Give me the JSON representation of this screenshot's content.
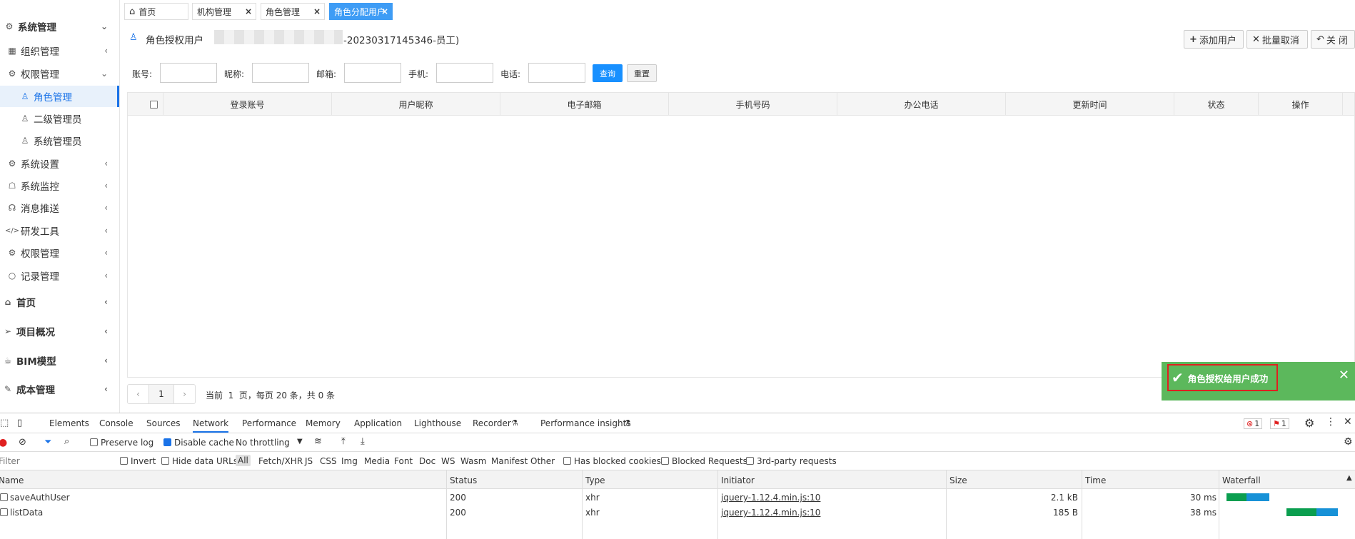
{
  "sidebar": {
    "items": [
      {
        "label": "系统管理",
        "icon": "gear-icon",
        "chev": "⌄"
      },
      {
        "label": "组织管理",
        "icon": "grid-icon",
        "chev": "‹"
      },
      {
        "label": "权限管理",
        "icon": "gear-icon",
        "chev": "⌄"
      },
      {
        "label": "角色管理",
        "icon": "user-icon"
      },
      {
        "label": "二级管理员",
        "icon": "user-icon"
      },
      {
        "label": "系统管理员",
        "icon": "users-icon"
      },
      {
        "label": "系统设置",
        "icon": "gear-icon",
        "chev": "‹"
      },
      {
        "label": "系统监控",
        "icon": "monitor-icon",
        "chev": "‹"
      },
      {
        "label": "消息推送",
        "icon": "headset-icon",
        "chev": "‹"
      },
      {
        "label": "研发工具",
        "icon": "code-icon",
        "chev": "‹"
      },
      {
        "label": "权限管理",
        "icon": "gear-icon",
        "chev": "‹"
      },
      {
        "label": "记录管理",
        "icon": "circle-icon",
        "chev": "‹"
      },
      {
        "label": "首页",
        "icon": "home-icon",
        "chev": "‹"
      },
      {
        "label": "项目概况",
        "icon": "send-icon",
        "chev": "‹"
      },
      {
        "label": "BIM模型",
        "icon": "cup-icon",
        "chev": "‹"
      },
      {
        "label": "成本管理",
        "icon": "pencil-icon",
        "chev": "‹"
      }
    ]
  },
  "tabs": [
    {
      "label": "首页",
      "icon": "home-icon"
    },
    {
      "label": "机构管理",
      "close": "×"
    },
    {
      "label": "角色管理",
      "close": "×"
    },
    {
      "label": "角色分配用户",
      "close": "×"
    }
  ],
  "header": {
    "title": "角色授权用户",
    "subtitle": "-20230317145346-员工)",
    "add_user": "添加用户",
    "batch_cancel": "批量取消",
    "close": "关 闭"
  },
  "search": {
    "account": "账号:",
    "nickname": "昵称:",
    "email": "邮箱:",
    "phone": "手机:",
    "tel": "电话:",
    "query": "查询",
    "reset": "重置"
  },
  "table": {
    "columns": [
      "登录账号",
      "用户昵称",
      "电子邮箱",
      "手机号码",
      "办公电话",
      "更新时间",
      "状态",
      "操作"
    ]
  },
  "pagination": {
    "prev": "‹",
    "page": "1",
    "next": "›",
    "info": "当前  1  页，每页 20 条，共 0 条"
  },
  "toast": {
    "message": "角色授权给用户成功",
    "close": "✕",
    "color": "#5cb85c"
  },
  "devtools": {
    "tabs": [
      "Elements",
      "Console",
      "Sources",
      "Network",
      "Performance",
      "Memory",
      "Application",
      "Lighthouse",
      "Recorder",
      "Performance insights"
    ],
    "errors": "1",
    "issues": "1",
    "preserve_log": "Preserve log",
    "disable_cache": "Disable cache",
    "throttling": "No throttling",
    "filter_placeholder": "Filter",
    "invert": "Invert",
    "hide_data_urls": "Hide data URLs",
    "types": [
      "All",
      "Fetch/XHR",
      "JS",
      "CSS",
      "Img",
      "Media",
      "Font",
      "Doc",
      "WS",
      "Wasm",
      "Manifest",
      "Other"
    ],
    "has_blocked_cookies": "Has blocked cookies",
    "blocked_requests": "Blocked Requests",
    "third_party": "3rd-party requests",
    "columns": [
      "Name",
      "Status",
      "Type",
      "Initiator",
      "Size",
      "Time",
      "Waterfall"
    ],
    "rows": [
      {
        "name": "saveAuthUser",
        "status": "200",
        "type": "xhr",
        "initiator": "jquery-1.12.4.min.js:10",
        "size": "2.1 kB",
        "time": "30 ms"
      },
      {
        "name": "listData",
        "status": "200",
        "type": "xhr",
        "initiator": "jquery-1.12.4.min.js:10",
        "size": "185 B",
        "time": "38 ms"
      }
    ]
  }
}
